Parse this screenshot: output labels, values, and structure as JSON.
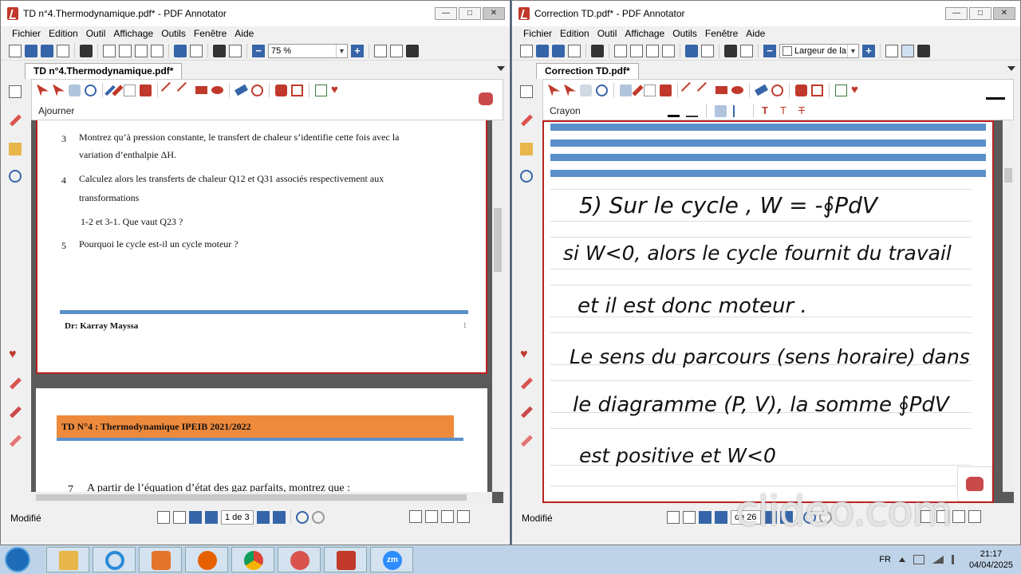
{
  "left_window": {
    "title": "TD n°4.Thermodynamique.pdf* - PDF Annotator",
    "menu": [
      "Fichier",
      "Edition",
      "Outil",
      "Affichage",
      "Outils",
      "Fenêtre",
      "Aide"
    ],
    "zoom": "75 %",
    "tab": "TD n°4.Thermodynamique.pdf*",
    "tool_label": "Ajourner",
    "status": "Modifié",
    "page_indicator": "1 de 3",
    "page1_lines": [
      {
        "num": "3",
        "text": "Montrez qu’à pression constante, le transfert de chaleur s’identifie cette fois avec la"
      },
      {
        "num": "",
        "text": "variation d’enthalpie ΔH."
      },
      {
        "num": "4",
        "text": "Calculez alors les transferts de chaleur Q12 et Q31 associés respectivement aux"
      },
      {
        "num": "",
        "text": "transformations"
      },
      {
        "num": "",
        "text": "1-2 et 3-1. Que vaut Q23 ?"
      },
      {
        "num": "5",
        "text": "Pourquoi le cycle est-il un cycle moteur ?"
      }
    ],
    "footer_author": "Dr: Karray Mayssa",
    "footer_page": "1",
    "page2_header": "TD N°4 : Thermodynamique IPEIB 2021/2022",
    "page2_q_num": "7",
    "page2_q_text": "A partir de l’équation d’état des gaz parfaits, montrez que :"
  },
  "right_window": {
    "title": "Correction TD.pdf* - PDF Annotator",
    "menu": [
      "Fichier",
      "Edition",
      "Outil",
      "Affichage",
      "Outils",
      "Fenêtre",
      "Aide"
    ],
    "zoom": "Largeur de la",
    "tab": "Correction TD.pdf*",
    "tool_label": "Crayon",
    "status": "Modifié",
    "page_indicator": "de 26",
    "handwriting": [
      "5) Sur le cycle , W = -∮PdV",
      "si W<0, alors le cycle fournit du travail",
      "et il est donc moteur .",
      "Le sens du parcours (sens horaire) dans",
      "le diagramme (P, V), la somme ∮PdV",
      "est positive et W<0"
    ]
  },
  "taskbar": {
    "language": "FR",
    "time": "21:17",
    "date": "04/04/2025",
    "zoom_app_label": "zm"
  },
  "watermark": "clideo.com",
  "colors": {
    "accent": "#3565a8",
    "stripe": "#5b8fc9",
    "page_border": "#bb2222",
    "orange_header": "#ee8a3c",
    "ink": "#111111"
  }
}
